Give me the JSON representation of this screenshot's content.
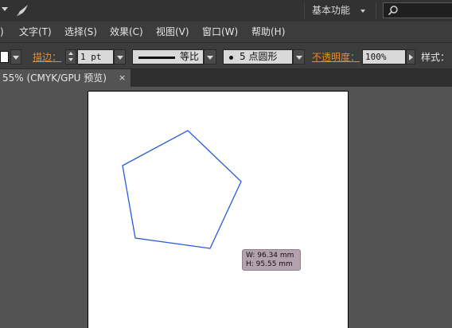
{
  "appbar": {
    "workspace_label": "基本功能",
    "search_placeholder": ""
  },
  "menu": {
    "items": [
      ")",
      "文字(T)",
      "选择(S)",
      "效果(C)",
      "视图(V)",
      "窗口(W)",
      "帮助(H)"
    ]
  },
  "control": {
    "stroke_label": "描边：",
    "stroke_weight": "1 pt",
    "stroke_profile": "等比",
    "brush_label": "5 点圆形",
    "opacity_label": "不透明度：",
    "opacity_value": "100%",
    "style_label": "样式："
  },
  "document": {
    "tab_title": "55% (CMYK/GPU 预览)",
    "close_glyph": "×"
  },
  "tooltip": {
    "width": "W: 96.34 mm",
    "height": "H: 95.55 mm"
  },
  "colors": {
    "shape_stroke": "#2a5bd7",
    "link_label": "#e88b2a",
    "tooltip_bg": "#b3a2ad"
  },
  "icons": [
    "rocket-icon",
    "search-icon",
    "dropdown-caret-icon",
    "close-icon",
    "play-icon"
  ]
}
